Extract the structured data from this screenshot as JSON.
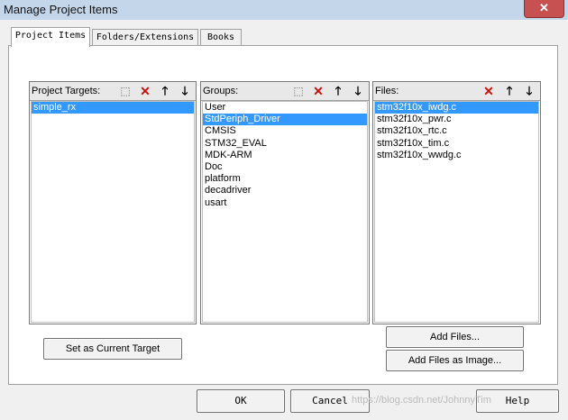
{
  "window": {
    "title": "Manage Project Items",
    "close_glyph": "✕"
  },
  "tabs": [
    {
      "label": "Project Items",
      "active": true
    },
    {
      "label": "Folders/Extensions",
      "active": false
    },
    {
      "label": "Books",
      "active": false
    }
  ],
  "targets": {
    "header": "Project Targets:",
    "items": [
      "simple_rx"
    ],
    "selected_index": 0
  },
  "groups": {
    "header": "Groups:",
    "items": [
      "User",
      "StdPeriph_Driver",
      "CMSIS",
      "STM32_EVAL",
      "MDK-ARM",
      "Doc",
      "platform",
      "decadriver",
      "usart"
    ],
    "selected_index": 1
  },
  "files": {
    "header": "Files:",
    "items": [
      "stm32f10x_iwdg.c",
      "stm32f10x_pwr.c",
      "stm32f10x_rtc.c",
      "stm32f10x_tim.c",
      "stm32f10x_wwdg.c"
    ],
    "selected_index": 0
  },
  "toolbar_icons": {
    "new": "new-item-icon",
    "delete": "delete-icon",
    "up": "move-up-icon",
    "down": "move-down-icon"
  },
  "buttons": {
    "set_current_target": "Set as Current Target",
    "add_files": "Add Files...",
    "add_files_as_image": "Add Files as Image...",
    "ok": "OK",
    "cancel": "Cancel",
    "help": "Help"
  },
  "watermark": "https://blog.csdn.net/JohnnyTim"
}
